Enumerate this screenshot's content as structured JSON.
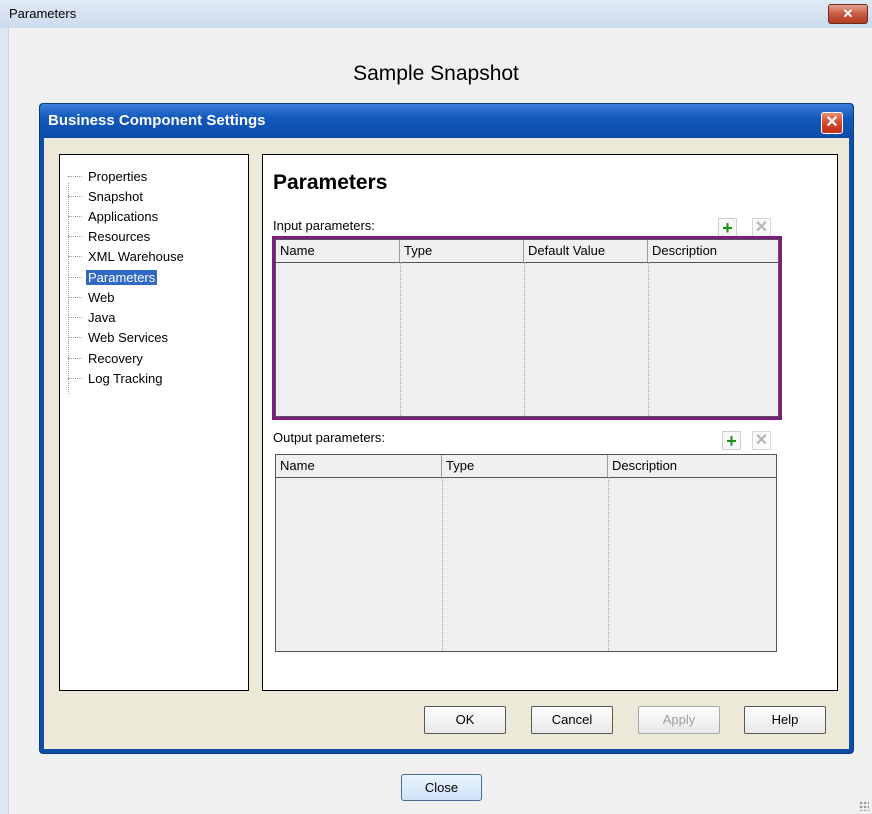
{
  "window": {
    "title": "Parameters",
    "close_glyph": "✕"
  },
  "page_title": "Sample Snapshot",
  "dialog": {
    "title": "Business Component Settings",
    "close_glyph": "✕",
    "tree": [
      {
        "label": "Properties",
        "selected": false
      },
      {
        "label": "Snapshot",
        "selected": false
      },
      {
        "label": "Applications",
        "selected": false
      },
      {
        "label": "Resources",
        "selected": false
      },
      {
        "label": "XML Warehouse",
        "selected": false
      },
      {
        "label": "Parameters",
        "selected": true
      },
      {
        "label": "Web",
        "selected": false
      },
      {
        "label": "Java",
        "selected": false
      },
      {
        "label": "Web Services",
        "selected": false
      },
      {
        "label": "Recovery",
        "selected": false
      },
      {
        "label": "Log Tracking",
        "selected": false
      }
    ],
    "section_heading": "Parameters",
    "input": {
      "label": "Input parameters:",
      "columns": [
        "Name",
        "Type",
        "Default Value",
        "Description"
      ],
      "rows": []
    },
    "output": {
      "label": "Output parameters:",
      "columns": [
        "Name",
        "Type",
        "Description"
      ],
      "rows": []
    },
    "icons": {
      "add": "+",
      "remove": "✕"
    },
    "buttons": {
      "ok": "OK",
      "cancel": "Cancel",
      "apply": "Apply",
      "help": "Help"
    }
  },
  "close_button": "Close",
  "colors": {
    "dialog_frame": "#0d4fa8",
    "highlight": "#7d1d7f",
    "selection": "#316ac5",
    "add_icon": "#1a8f1a"
  }
}
